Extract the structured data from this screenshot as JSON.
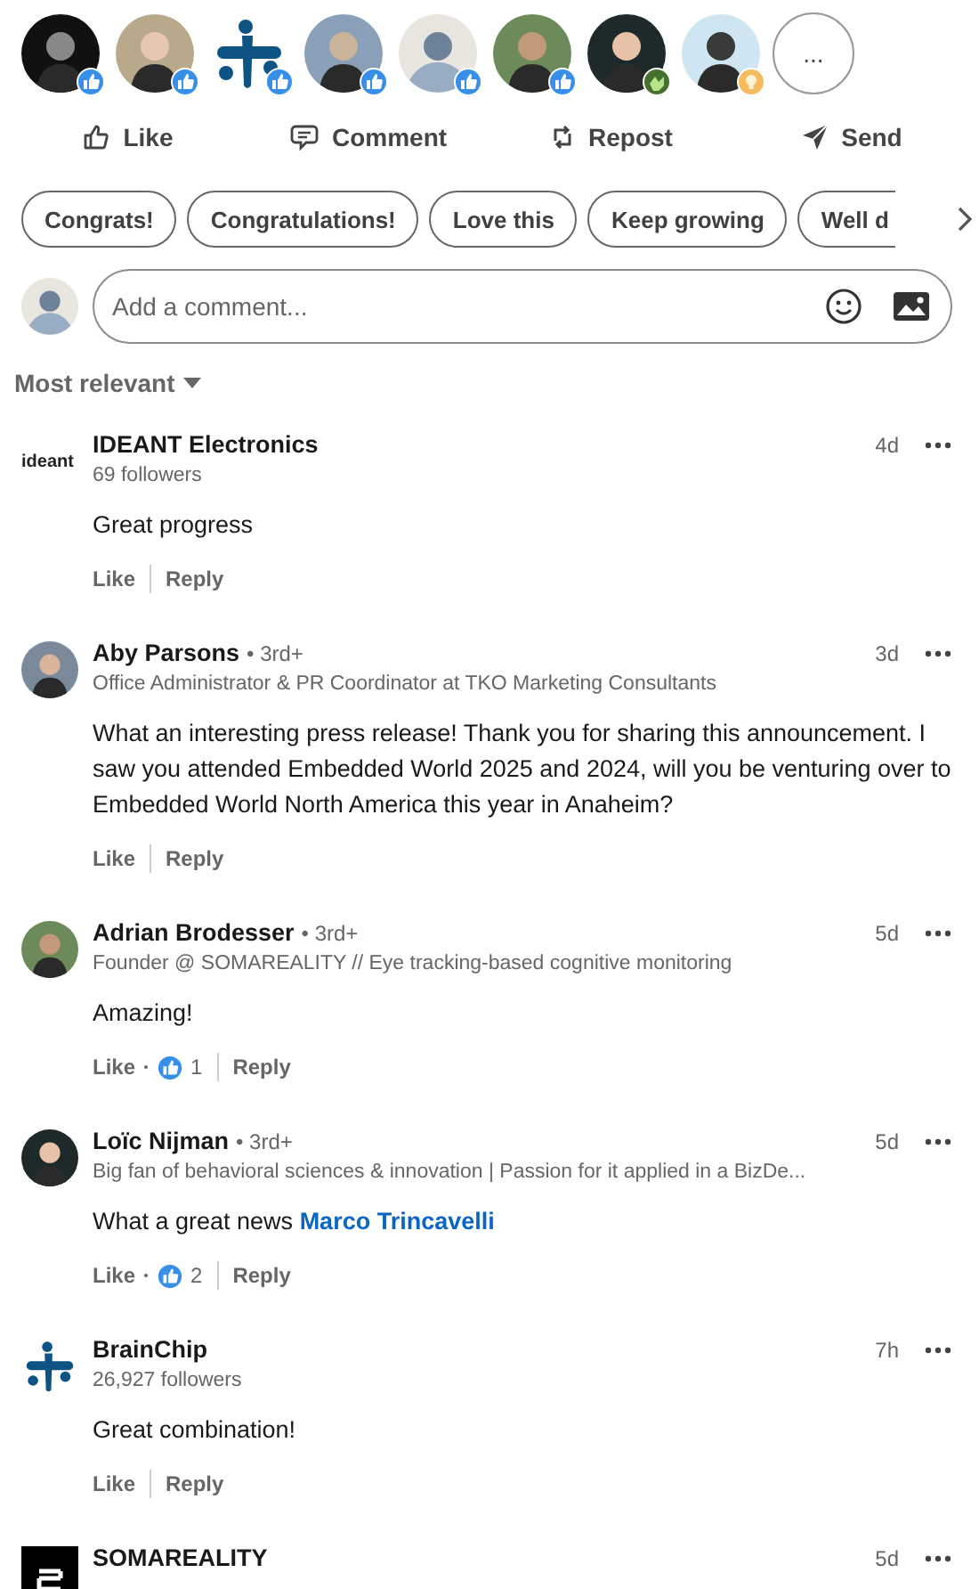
{
  "reactors": [
    {
      "badge": {
        "kind": "like"
      }
    },
    {
      "badge": {
        "kind": "like"
      }
    },
    {
      "kind": "logo",
      "badge": {
        "kind": "like"
      }
    },
    {
      "badge": {
        "kind": "like"
      }
    },
    {
      "kind": "placeholder",
      "badge": {
        "kind": "like"
      }
    },
    {
      "badge": {
        "kind": "like"
      }
    },
    {
      "badge": {
        "kind": "support"
      }
    },
    {
      "badge": {
        "kind": "insightful"
      }
    }
  ],
  "more_reactors": "...",
  "actions": [
    {
      "kind": "like",
      "label": "Like"
    },
    {
      "kind": "comment",
      "label": "Comment"
    },
    {
      "kind": "repost",
      "label": "Repost"
    },
    {
      "kind": "send",
      "label": "Send"
    }
  ],
  "suggestions": [
    "Congrats!",
    "Congratulations!",
    "Love this",
    "Keep growing",
    "Well d"
  ],
  "composer": {
    "placeholder": "Add a comment..."
  },
  "sort": "Most relevant",
  "comments": [
    {
      "kind": "ideant",
      "avatar_text": "ideant",
      "author": "IDEANT Electronics",
      "subtitle": "69 followers",
      "time": "4d",
      "body": "Great progress",
      "like": "Like",
      "reply": "Reply"
    },
    {
      "author": "Aby Parsons",
      "degree": "• 3rd+",
      "subtitle": "Office Administrator & PR Coordinator at TKO Marketing Consultants",
      "time": "3d",
      "body": "What an interesting press release! Thank you for sharing this announcement. I saw you attended Embedded World 2025 and 2024, will you be venturing over to Embedded World North America this year in Anaheim?",
      "like": "Like",
      "reply": "Reply"
    },
    {
      "author": "Adrian Brodesser",
      "degree": "• 3rd+",
      "subtitle": "Founder @ SOMAREALITY // Eye tracking-based cognitive monitoring",
      "time": "5d",
      "body": "Amazing!",
      "like": "Like",
      "reaction_count": "1",
      "reply": "Reply"
    },
    {
      "author": "Loïc Nijman",
      "degree": "• 3rd+",
      "subtitle": "Big fan of behavioral sciences & innovation | Passion for it applied in a BizDe...",
      "time": "5d",
      "body": "What a great news ",
      "mention": "Marco Trincavelli",
      "like": "Like",
      "reaction_count": "2",
      "reply": "Reply"
    },
    {
      "kind": "brainchip",
      "author": "BrainChip",
      "subtitle": "26,927 followers",
      "time": "7h",
      "body": "Great combination!",
      "like": "Like",
      "reply": "Reply"
    },
    {
      "kind": "soma",
      "author": "SOMAREALITY",
      "time": "5d"
    }
  ]
}
